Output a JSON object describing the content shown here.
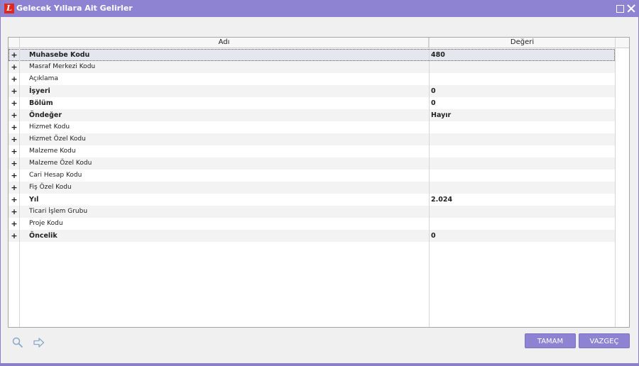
{
  "window": {
    "title": "Gelecek Yıllara Ait Gelirler",
    "logo_letter": "L",
    "accent_color": "#8e83d3",
    "logo_color": "#e0281e"
  },
  "grid": {
    "columns": {
      "name": "Adı",
      "value": "Değeri"
    },
    "rows": [
      {
        "expander": "+",
        "name": "Muhasebe Kodu",
        "value": "480",
        "bold": true
      },
      {
        "expander": "+",
        "name": "Masraf Merkezi Kodu",
        "value": "",
        "bold": false
      },
      {
        "expander": "+",
        "name": "Açıklama",
        "value": "",
        "bold": false
      },
      {
        "expander": "+",
        "name": "İşyeri",
        "value": "0",
        "bold": true
      },
      {
        "expander": "+",
        "name": "Bölüm",
        "value": "0",
        "bold": true
      },
      {
        "expander": "+",
        "name": "Öndeğer",
        "value": "Hayır",
        "bold": true
      },
      {
        "expander": "+",
        "name": "Hizmet Kodu",
        "value": "",
        "bold": false
      },
      {
        "expander": "+",
        "name": "Hizmet Özel Kodu",
        "value": "",
        "bold": false
      },
      {
        "expander": "+",
        "name": "Malzeme Kodu",
        "value": "",
        "bold": false
      },
      {
        "expander": "+",
        "name": "Malzeme Özel Kodu",
        "value": "",
        "bold": false
      },
      {
        "expander": "+",
        "name": "Cari Hesap Kodu",
        "value": "",
        "bold": false
      },
      {
        "expander": "+",
        "name": "Fiş Özel Kodu",
        "value": "",
        "bold": false
      },
      {
        "expander": "+",
        "name": "Yıl",
        "value": "2.024",
        "bold": true
      },
      {
        "expander": "+",
        "name": "Ticari İşlem Grubu",
        "value": "",
        "bold": false
      },
      {
        "expander": "+",
        "name": "Proje Kodu",
        "value": "",
        "bold": false
      },
      {
        "expander": "+",
        "name": "Öncelik",
        "value": "0",
        "bold": true
      }
    ]
  },
  "footer": {
    "search_icon": "search-icon",
    "forward_icon": "arrow-right-icon",
    "ok_label": "TAMAM",
    "cancel_label": "VAZGEÇ"
  }
}
